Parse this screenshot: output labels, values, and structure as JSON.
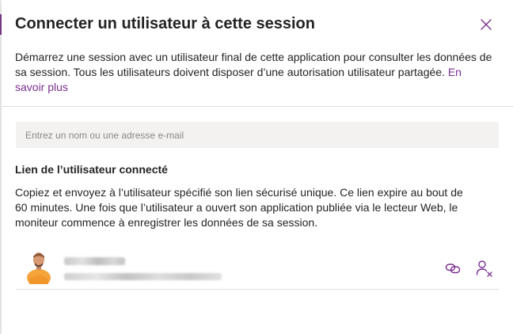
{
  "dialog": {
    "title": "Connecter un utilisateur à cette session",
    "description": "Démarrez une session avec un utilisateur final de cette application pour consulter les données de sa session. Tous les utilisateurs doivent disposer d’une autorisation utilisateur partagée. ",
    "learn_more": "En savoir plus",
    "search_placeholder": "Entrez un nom ou une adresse e-mail",
    "section_label": "Lien de l’utilisateur connecté",
    "section_text": "Copiez et envoyez à l’utilisateur spécifié son lien sécurisé unique. Ce lien expire au bout de 60 minutes. Une fois que l’utilisateur a ouvert son application publiée via le lecteur Web, le moniteur commence à enregistrer les données de sa session."
  },
  "icons": {
    "close": "close-icon",
    "copy_link": "link-icon",
    "remove_user": "remove-user-icon"
  },
  "colors": {
    "accent": "#7a2f8f",
    "input_bg": "#f3f2f1",
    "divider": "#e1dfdd"
  }
}
